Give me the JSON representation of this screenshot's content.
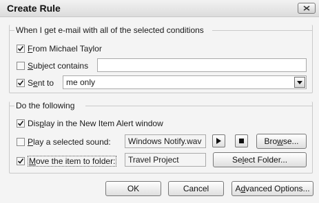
{
  "dialog": {
    "title": "Create Rule"
  },
  "conditions": {
    "heading": "When I get e-mail with all of the selected conditions",
    "from": {
      "pre": "",
      "ul": "F",
      "post": "rom Michael Taylor",
      "checked": true
    },
    "subject": {
      "pre": "",
      "ul": "S",
      "post": "ubject contains",
      "checked": false,
      "value": ""
    },
    "sent_to": {
      "pre": "S",
      "ul": "e",
      "post": "nt to",
      "checked": true,
      "value": "me only"
    }
  },
  "actions": {
    "heading": "Do the following",
    "alert": {
      "pre": "Dis",
      "ul": "p",
      "post": "lay in the New Item Alert window",
      "checked": true
    },
    "sound": {
      "pre": "",
      "ul": "P",
      "post": "lay a selected sound:",
      "checked": false,
      "value": "Windows Notify.wav"
    },
    "move": {
      "pre": "",
      "ul": "M",
      "post": "ove the item to folder:",
      "checked": true,
      "value": "Travel Project"
    },
    "browse": {
      "pre": "Bro",
      "ul": "w",
      "post": "se..."
    },
    "select_folder": {
      "pre": "Se",
      "ul": "l",
      "post": "ect Folder..."
    }
  },
  "footer": {
    "ok_label": "OK",
    "cancel_label": "Cancel",
    "advanced": {
      "pre": "A",
      "ul": "d",
      "post": "vanced Options..."
    }
  },
  "icons": {
    "close": "close-icon",
    "play": "play-icon",
    "stop": "stop-icon",
    "dropdown": "chevron-down-icon",
    "check": "checkmark-icon"
  }
}
